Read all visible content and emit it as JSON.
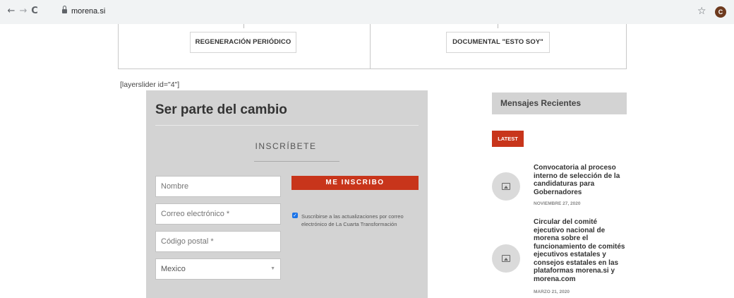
{
  "browser": {
    "url": "morena.si",
    "back_icon": "←",
    "forward_icon": "→",
    "reload_icon": "C",
    "star_icon": "☆",
    "profile_initial": "C"
  },
  "top_buttons": {
    "left_label": "REGENERACIÓN PERIÓDICO",
    "right_label": "DOCUMENTAL \"ESTO SOY\""
  },
  "shortcode_text": "[layerslider id=\"4\"]",
  "form": {
    "title": "Ser parte del cambio",
    "subscribe_heading": "INSCRÍBETE",
    "name_placeholder": "Nombre",
    "email_placeholder": "Correo electrónico *",
    "postal_placeholder": "Código postal *",
    "country_selected": "Mexico",
    "submit_label": "ME INSCRIBO",
    "consent_checked": true,
    "consent_text": "Suscribirse a las actualizaciones por correo electrónico de La Cuarta Transformación"
  },
  "sidebar": {
    "heading": "Mensajes Recientes",
    "latest_badge": "LATEST",
    "posts": [
      {
        "title": "Convocatoria al proceso interno de selección de la candidaturas para Gobernadores",
        "date": "NOVIEMBRE 27, 2020"
      },
      {
        "title": "Circular del comité ejecutivo nacional de morena sobre el funcionamiento de comités ejecutivos estatales y consejos estatales en las plataformas morena.si y morena.com",
        "date": "MARZO 21, 2020"
      }
    ]
  },
  "colors": {
    "accent_red": "#c8351b",
    "panel_gray": "#d3d3d3"
  }
}
